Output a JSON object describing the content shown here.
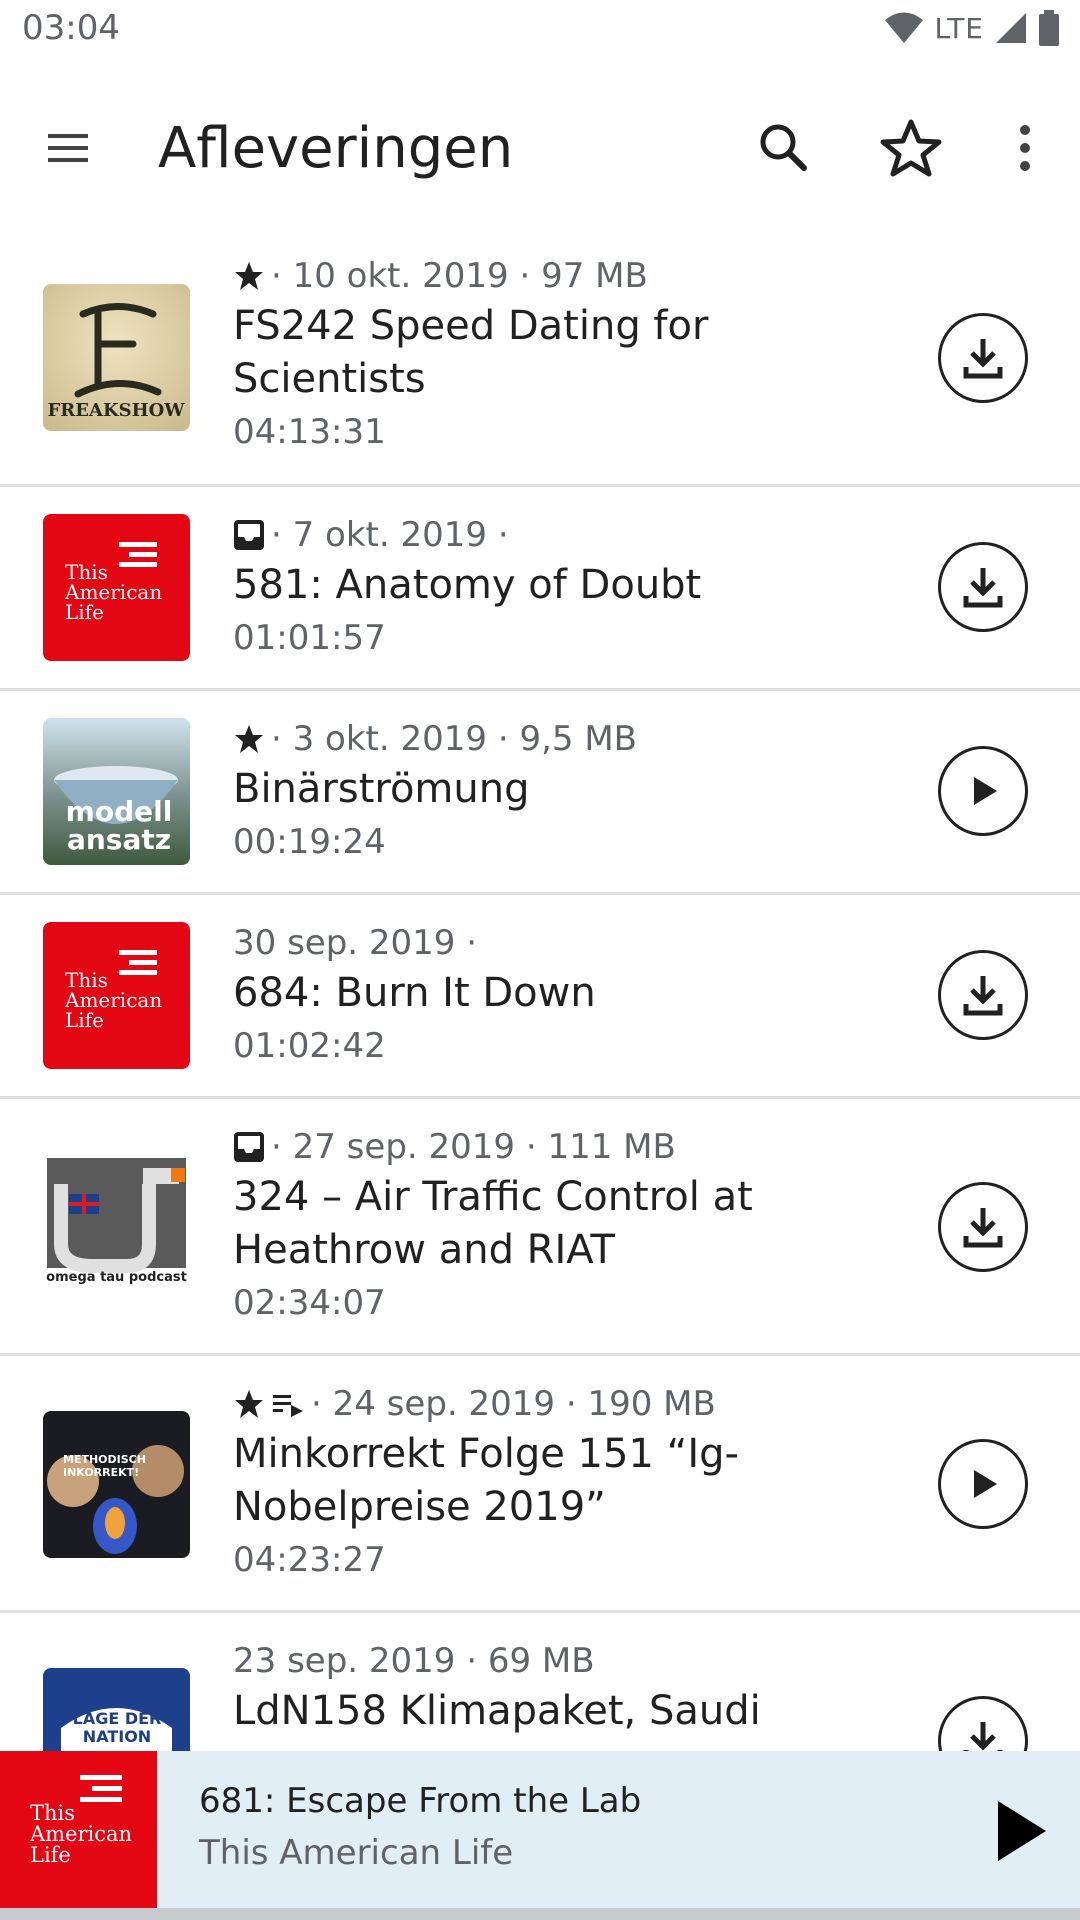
{
  "status": {
    "time": "03:04",
    "network": "LTE"
  },
  "appbar": {
    "title": "Afleveringen"
  },
  "episodes": [
    {
      "meta": "· 10 okt. 2019 · 97 MB",
      "title": "FS242 Speed Dating for Scientists",
      "duration": "04:13:31",
      "cover_text": "FREAKSHOW",
      "action": "download"
    },
    {
      "meta": "· 7 okt. 2019 ·",
      "title": "581: Anatomy of Doubt",
      "duration": "01:01:57",
      "cover_text": "This American Life",
      "action": "download"
    },
    {
      "meta": "· 3 okt. 2019 · 9,5 MB",
      "title": "Binärströmung",
      "duration": "00:19:24",
      "cover_text": "modell ansatz",
      "action": "play"
    },
    {
      "meta": "30 sep. 2019 ·",
      "title": "684: Burn It Down",
      "duration": "01:02:42",
      "cover_text": "This American Life",
      "action": "download"
    },
    {
      "meta": "· 27 sep. 2019 · 111 MB",
      "title": "324 – Air Traffic Control at Heathrow and RIAT",
      "duration": "02:34:07",
      "cover_text": "omega tau podcast",
      "action": "download"
    },
    {
      "meta": "· 24 sep. 2019 · 190 MB",
      "title": "Minkorrekt Folge 151 “Ig-Nobelpreise 2019”",
      "duration": "04:23:27",
      "cover_text": "METHODISCH INKORREKT!",
      "action": "play"
    },
    {
      "meta": "23 sep. 2019 · 69 MB",
      "title": "LdN158 Klimapaket, Saudi",
      "cover_text": "LAGE DER NATION",
      "action": "download"
    }
  ],
  "player": {
    "title": "681: Escape From the Lab",
    "feed": "This American Life",
    "cover_text": "This American Life"
  },
  "colors": {
    "accent_red": "#e30613",
    "player_bg": "#e1eef6"
  }
}
